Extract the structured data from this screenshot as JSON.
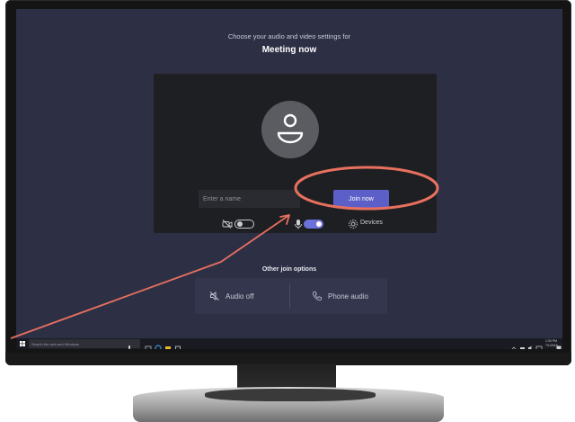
{
  "meeting": {
    "subtitle": "Choose your audio and video settings for",
    "title": "Meeting now"
  },
  "join": {
    "name_placeholder": "Enter a name",
    "join_label": "Join now"
  },
  "controls": {
    "camera_on": false,
    "mic_on": true,
    "devices_label": "Devices"
  },
  "other_options": {
    "title": "Other join options",
    "audio_off_label": "Audio off",
    "phone_audio_label": "Phone audio"
  },
  "taskbar": {
    "search_placeholder": "Search the web and Windows",
    "clock_time": "1:33 PM",
    "clock_date": "7/1/2016"
  },
  "colors": {
    "screen_bg": "#2d2f45",
    "panel_bg": "#1e1f22",
    "accent": "#5b5fc7",
    "annotation": "#e8705f"
  },
  "icons": {
    "avatar": "person-icon",
    "camera": "camera-off-icon",
    "mic": "microphone-icon",
    "devices": "gear-icon",
    "audio_off": "speaker-off-icon",
    "phone": "phone-icon"
  }
}
